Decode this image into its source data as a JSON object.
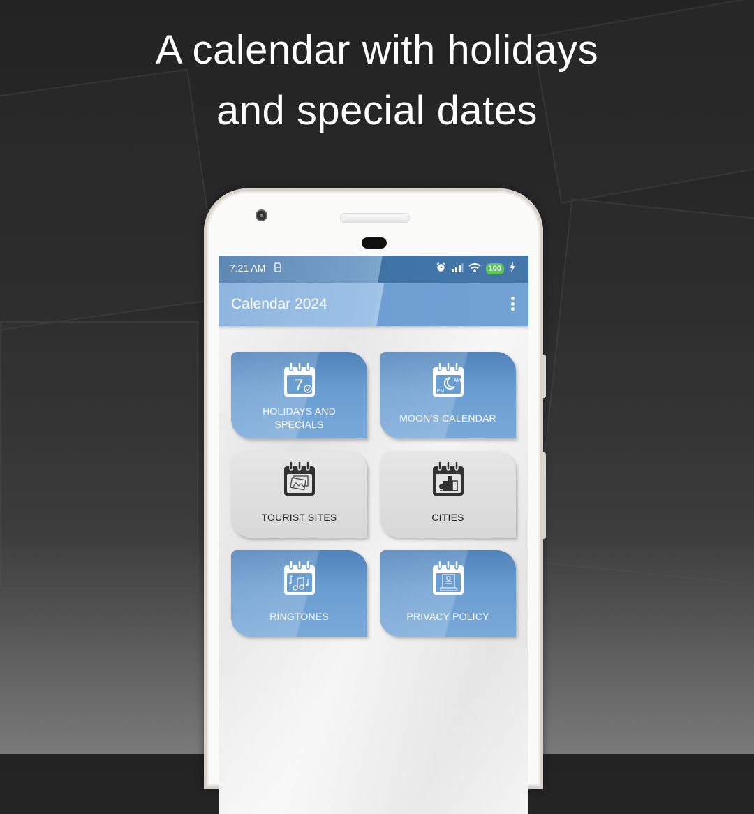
{
  "promo": {
    "headline_line1": "A calendar with holidays",
    "headline_line2": "and special dates"
  },
  "status_bar": {
    "time": "7:21 AM",
    "sim_icon": "sim-icon",
    "icons": [
      "alarm-icon",
      "signal-icon",
      "wifi-icon"
    ],
    "battery_level": "100",
    "charging_icon": "charging-bolt-icon"
  },
  "app_bar": {
    "title": "Calendar 2024",
    "menu_icon": "more-vert-icon"
  },
  "menu": {
    "tiles": [
      {
        "label_line1": "HOLIDAYS AND",
        "label_line2": "SPECIALS",
        "icon": "calendar-day-check-icon",
        "icon_day": "7",
        "style": "blue"
      },
      {
        "label_line1": "MOON'S CALENDAR",
        "icon": "calendar-moon-icon",
        "icon_am": "AM",
        "icon_pm": "PM",
        "style": "blue"
      },
      {
        "label_line1": "TOURIST SITES",
        "icon": "calendar-photos-icon",
        "style": "gray"
      },
      {
        "label_line1": "CITIES",
        "icon": "calendar-city-icon",
        "style": "gray"
      },
      {
        "label_line1": "RINGTONES",
        "icon": "calendar-music-icon",
        "style": "blue"
      },
      {
        "label_line1": "PRIVACY POLICY",
        "icon": "calendar-document-icon",
        "style": "blue"
      }
    ]
  },
  "colors": {
    "app_bar": "#72a3d4",
    "status_bar": "#4677aa",
    "tile_blue": "#6a9dd0",
    "tile_gray": "#dedede",
    "battery": "#5cc35d"
  }
}
